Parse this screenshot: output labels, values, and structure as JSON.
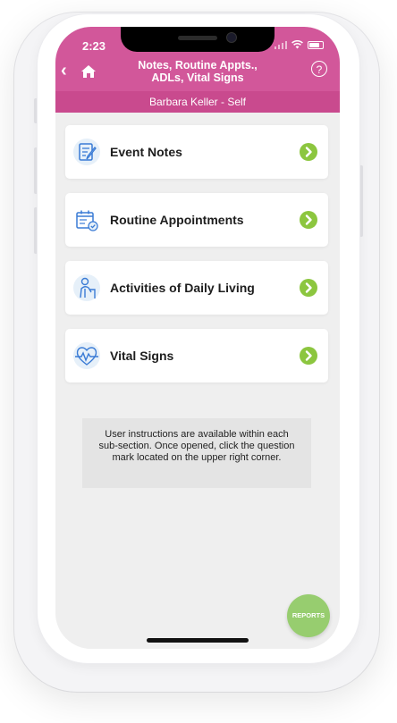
{
  "status_bar": {
    "time": "2:23"
  },
  "header": {
    "title_line1": "Notes, Routine Appts.,",
    "title_line2": "ADLs, Vital Signs",
    "help_label": "?",
    "back_label": "‹",
    "subtitle": "Barbara Keller - Self"
  },
  "menu": [
    {
      "label": "Event Notes",
      "icon": "notepad-pencil-icon"
    },
    {
      "label": "Routine Appointments",
      "icon": "calendar-check-icon"
    },
    {
      "label": "Activities of Daily Living",
      "icon": "person-walker-icon"
    },
    {
      "label": "Vital Signs",
      "icon": "heart-pulse-icon"
    }
  ],
  "info": {
    "text": "User instructions are available within each sub-section. Once opened, click the question mark located on the upper right corner."
  },
  "reports_button": {
    "label": "REPORTS"
  },
  "colors": {
    "header": "#d2579a",
    "subheader": "#c94a8e",
    "chevron": "#8cc63f",
    "reports": "#97cd6f",
    "background": "#efefef"
  }
}
